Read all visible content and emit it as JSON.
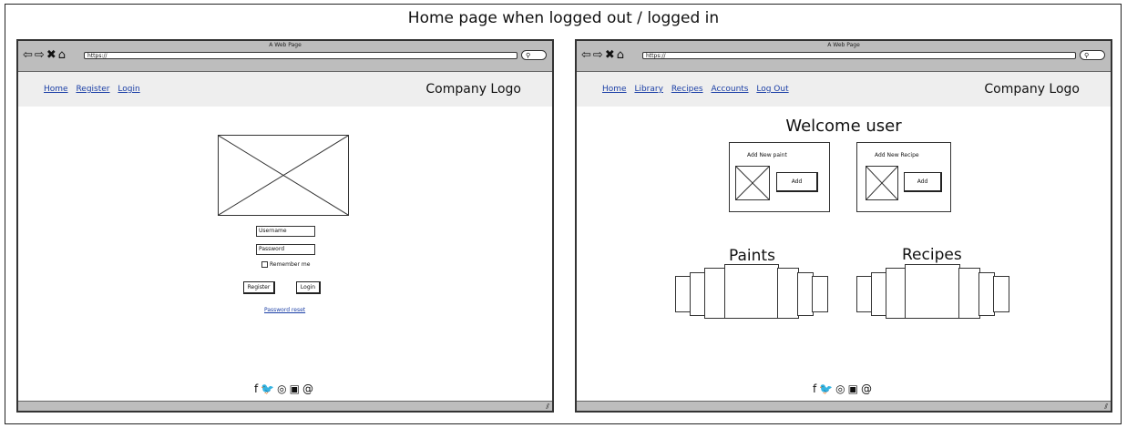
{
  "header": {
    "title": "Home page when logged out / logged in"
  },
  "browser": {
    "window_title": "A Web Page",
    "url": "https://"
  },
  "logged_out": {
    "nav_links": [
      "Home",
      "Register",
      "Login"
    ],
    "logo": "Company Logo",
    "username_field": "Username",
    "password_field": "Password",
    "remember_me": "Remember me",
    "register_button": "Register",
    "login_button": "Login",
    "password_reset_link": "Password reset"
  },
  "logged_in": {
    "nav_links": [
      "Home",
      "Library",
      "Recipes",
      "Accounts",
      "Log Out"
    ],
    "logo": "Company Logo",
    "welcome": "Welcome user",
    "add_paint_label": "Add New paint",
    "add_recipe_label": "Add New Recipe",
    "add_button": "Add",
    "paints_heading": "Paints",
    "recipes_heading": "Recipes"
  },
  "footer": {
    "icons": [
      "facebook-icon",
      "twitter-icon",
      "instagram-icon",
      "linkedin-icon",
      "at-icon"
    ]
  },
  "colors": {
    "link": "#1b3fa6",
    "chrome": "#bdbdbd",
    "navbar": "#eeeeee"
  }
}
